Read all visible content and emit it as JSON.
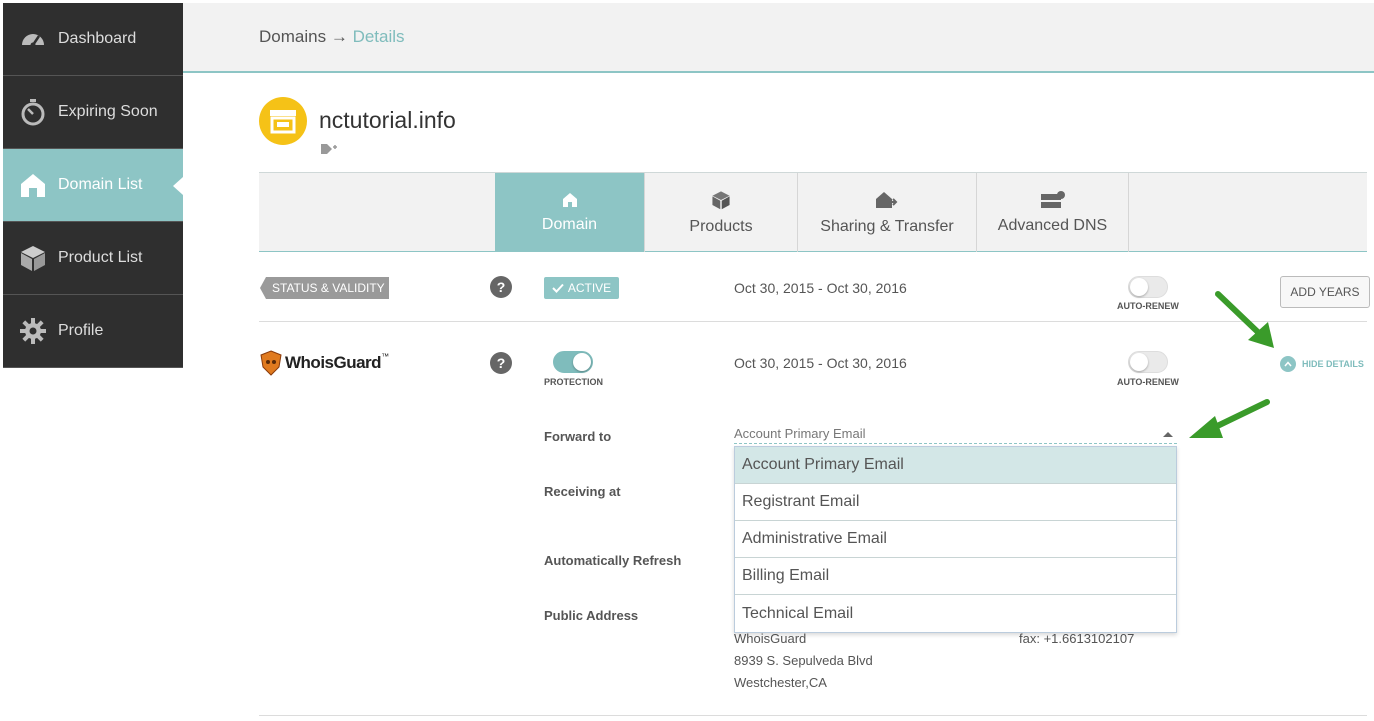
{
  "sidebar": {
    "items": [
      {
        "label": "Dashboard",
        "icon": "gauge-icon"
      },
      {
        "label": "Expiring Soon",
        "icon": "stopwatch-icon"
      },
      {
        "label": "Domain List",
        "icon": "home-icon",
        "active": true
      },
      {
        "label": "Product List",
        "icon": "box-icon"
      },
      {
        "label": "Profile",
        "icon": "gear-icon"
      }
    ]
  },
  "breadcrumb": {
    "parent": "Domains",
    "separator": "→",
    "current": "Details"
  },
  "domain": {
    "name": "nctutorial.info",
    "icon": "storefront-icon"
  },
  "tabs": [
    {
      "label": "Domain",
      "icon": "home-icon",
      "active": true
    },
    {
      "label": "Products",
      "icon": "box-icon"
    },
    {
      "label": "Sharing & Transfer",
      "icon": "transfer-icon"
    },
    {
      "label": "Advanced DNS",
      "icon": "server-icon"
    }
  ],
  "status_row": {
    "tag": "STATUS & VALIDITY",
    "help": "?",
    "badge": "ACTIVE",
    "dates": "Oct 30, 2015 - Oct 30, 2016",
    "autorenew_label": "AUTO-RENEW",
    "add_years": "ADD YEARS"
  },
  "whoisguard": {
    "logo_text": "WhoisGuard",
    "logo_tm": "™",
    "help": "?",
    "protection_label": "PROTECTION",
    "dates": "Oct 30, 2015 - Oct 30, 2016",
    "autorenew_label": "AUTO-RENEW",
    "hide_details": "HIDE DETAILS",
    "forward_label": "Forward to",
    "forward_value": "Account Primary Email",
    "receiving_label": "Receiving at",
    "refresh_label": "Automatically Refresh",
    "public_address_label": "Public Address",
    "dropdown_options": [
      "Account Primary Email",
      "Registrant Email",
      "Administrative Email",
      "Billing Email",
      "Technical Email"
    ],
    "address_lines": [
      "WhoisGuard",
      "8939 S. Sepulveda Blvd",
      "Westchester,CA"
    ],
    "fax": "fax: +1.6613102107"
  },
  "colors": {
    "accent": "#8dc5c5",
    "sidebar": "#2f2f2f",
    "domain_icon": "#f5c217",
    "arrow": "#3a9b2a"
  }
}
